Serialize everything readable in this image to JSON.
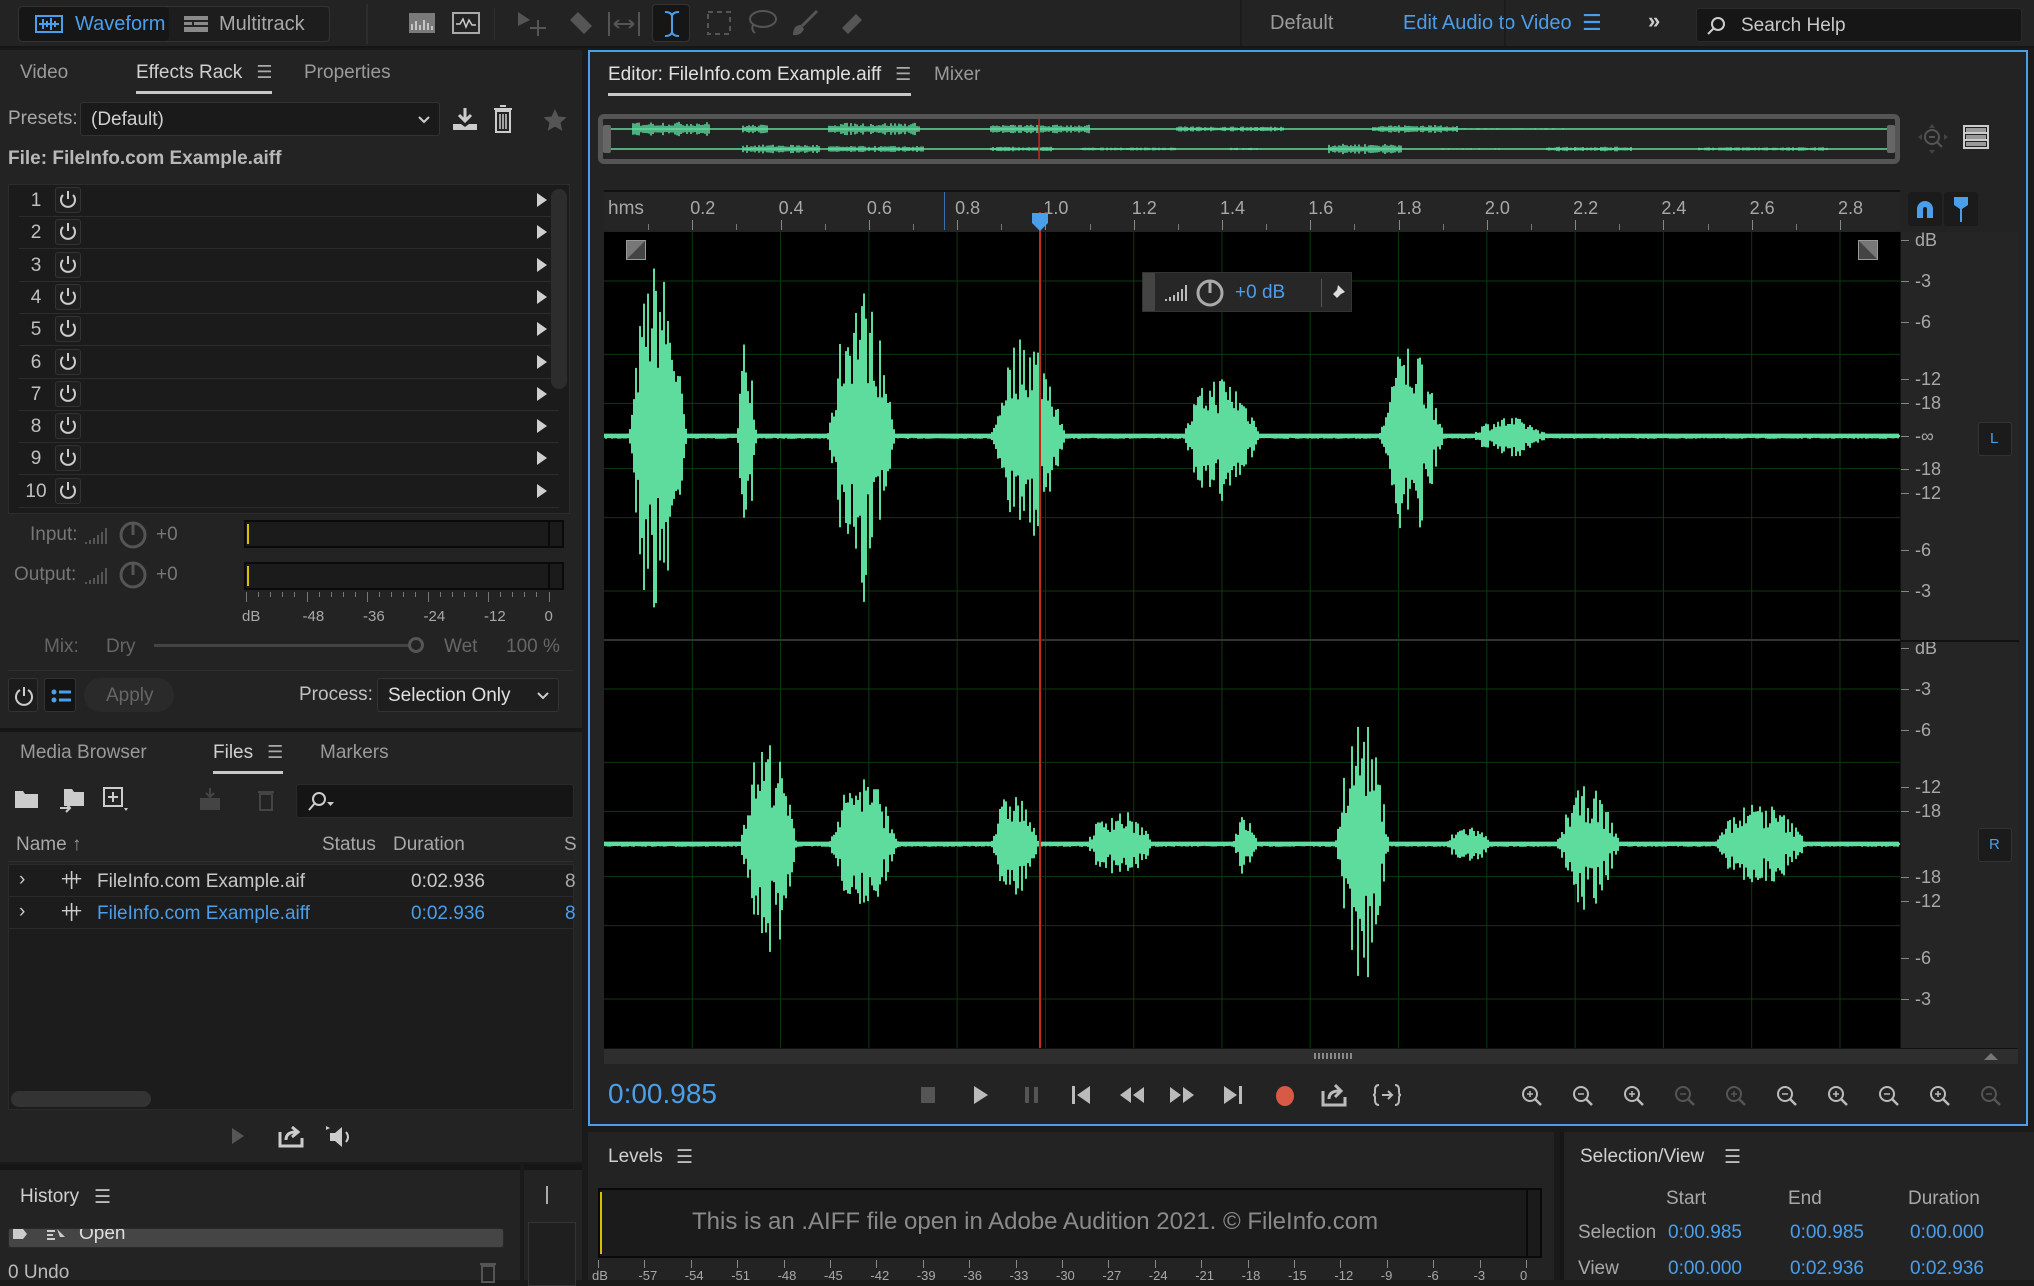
{
  "topbar": {
    "workspaces": [
      {
        "label": "Waveform",
        "active": true
      },
      {
        "label": "Multitrack",
        "active": false
      }
    ],
    "tools": [
      "spectral-frequency-display-icon",
      "spectral-pitch-display-icon",
      "move-tool-icon",
      "razor-tool-icon",
      "slip-tool-icon",
      "time-selection-tool-icon",
      "marquee-selection-tool-icon",
      "lasso-selection-tool-icon",
      "brush-selection-tool-icon",
      "spot-healing-brush-icon"
    ],
    "workspace_default": "Default",
    "workspace_active": "Edit Audio to Video",
    "search_placeholder": "Search Help"
  },
  "effects_panel": {
    "tabs": [
      {
        "label": "Video"
      },
      {
        "label": "Effects Rack",
        "active": true
      },
      {
        "label": "Properties"
      }
    ],
    "presets_label": "Presets:",
    "presets_value": "(Default)",
    "file_label": "File: FileInfo.com Example.aiff",
    "slots": [
      "1",
      "2",
      "3",
      "4",
      "5",
      "6",
      "7",
      "8",
      "9",
      "10"
    ],
    "input_label": "Input:",
    "input_value": "+0",
    "output_label": "Output:",
    "output_value": "+0",
    "meter_scale": [
      "dB",
      "-48",
      "-36",
      "-24",
      "-12",
      "0"
    ],
    "mix_label": "Mix:",
    "mix_dry": "Dry",
    "mix_wet": "Wet",
    "mix_value": "100 %",
    "mix_fraction": 1.0,
    "apply_label": "Apply",
    "process_label": "Process:",
    "process_value": "Selection Only"
  },
  "files_panel": {
    "tabs": [
      {
        "label": "Media Browser"
      },
      {
        "label": "Files",
        "active": true
      },
      {
        "label": "Markers"
      }
    ],
    "columns": [
      "Name",
      "Status",
      "Duration",
      "S"
    ],
    "rows": [
      {
        "name": "FileInfo.com Example.aif",
        "status": "",
        "duration": "0:02.936",
        "extra": "8",
        "selected": false
      },
      {
        "name": "FileInfo.com Example.aiff",
        "status": "",
        "duration": "0:02.936",
        "extra": "8",
        "selected": true
      }
    ]
  },
  "history_panel": {
    "title": "History",
    "items": [
      {
        "label": "Open"
      }
    ],
    "undo_count": "0 Undo"
  },
  "editor": {
    "tabs": [
      {
        "label": "Editor: FileInfo.com Example.aiff",
        "active": true
      },
      {
        "label": "Mixer"
      }
    ],
    "ruler_unit": "hms",
    "ruler_ticks": [
      "0.2",
      "0.4",
      "0.6",
      "0.8",
      "1.0",
      "1.2",
      "1.4",
      "1.6",
      "1.8",
      "2.0",
      "2.2",
      "2.4",
      "2.6",
      "2.8"
    ],
    "view_duration_s": 2.936,
    "playhead_s": 0.985,
    "hud_gain": "+0 dB",
    "channel_L": "L",
    "channel_R": "R",
    "db_scale": [
      "dB",
      "-3",
      "-6",
      "-12",
      "-18",
      "-∞",
      "-18",
      "-12",
      "-6",
      "-3"
    ],
    "time_display": "0:00.985",
    "waveform_color": "#5ddc9e",
    "playhead_color": "#c8281e",
    "accent_color": "#4b9eea"
  },
  "levels_panel": {
    "title": "Levels",
    "overlay_text": "This is an .AIFF file open in Adobe Audition 2021. © FileInfo.com",
    "scale": [
      "dB",
      "-57",
      "-54",
      "-51",
      "-48",
      "-45",
      "-42",
      "-39",
      "-36",
      "-33",
      "-30",
      "-27",
      "-24",
      "-21",
      "-18",
      "-15",
      "-12",
      "-9",
      "-6",
      "-3",
      "0"
    ]
  },
  "selection_view": {
    "title": "Selection/View",
    "headers": [
      "Start",
      "End",
      "Duration"
    ],
    "rows": [
      {
        "label": "Selection",
        "start": "0:00.985",
        "end": "0:00.985",
        "duration": "0:00.000"
      },
      {
        "label": "View",
        "start": "0:00.000",
        "end": "0:02.936",
        "duration": "0:02.936"
      }
    ]
  }
}
